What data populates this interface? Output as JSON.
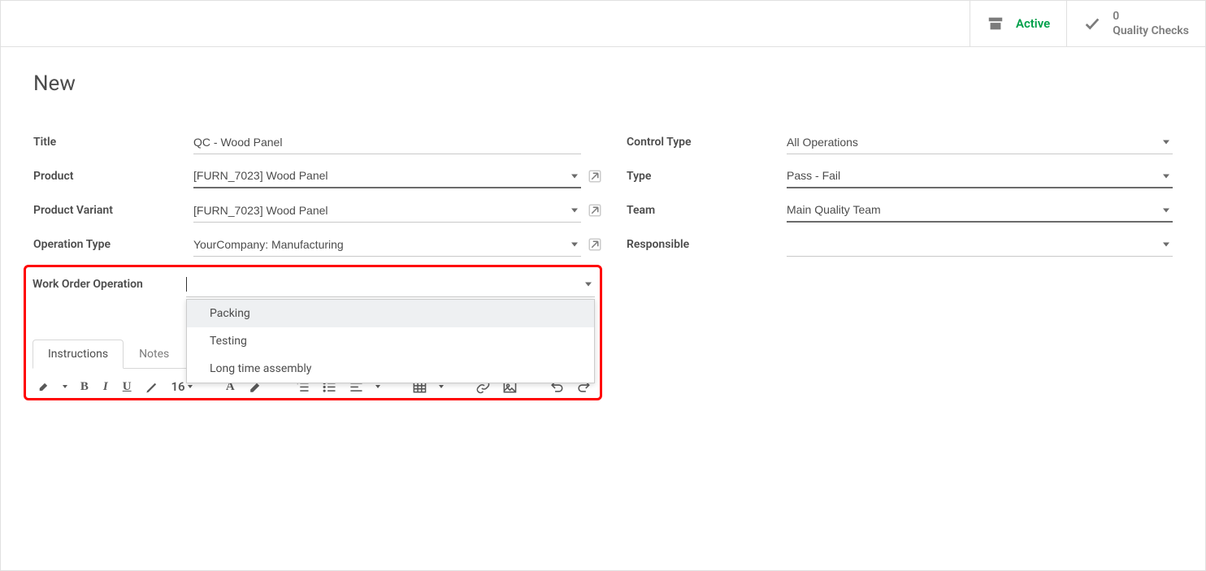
{
  "header": {
    "active_label": "Active",
    "checks_count": "0",
    "checks_label": "Quality Checks"
  },
  "page_title": "New",
  "fields": {
    "title": {
      "label": "Title",
      "value": "QC - Wood Panel"
    },
    "product": {
      "label": "Product",
      "value": "[FURN_7023] Wood Panel"
    },
    "product_variant": {
      "label": "Product Variant",
      "value": "[FURN_7023] Wood Panel"
    },
    "operation_type": {
      "label": "Operation Type",
      "value": "YourCompany: Manufacturing"
    },
    "work_order_operation": {
      "label": "Work Order Operation",
      "value": ""
    },
    "control_type": {
      "label": "Control Type",
      "value": "All Operations"
    },
    "type": {
      "label": "Type",
      "value": "Pass - Fail"
    },
    "team": {
      "label": "Team",
      "value": "Main Quality Team"
    },
    "responsible": {
      "label": "Responsible",
      "value": ""
    }
  },
  "dropdown_options": [
    "Packing",
    "Testing",
    "Long time assembly"
  ],
  "tabs": [
    "Instructions",
    "Notes"
  ],
  "toolbar_fontsize": "16"
}
